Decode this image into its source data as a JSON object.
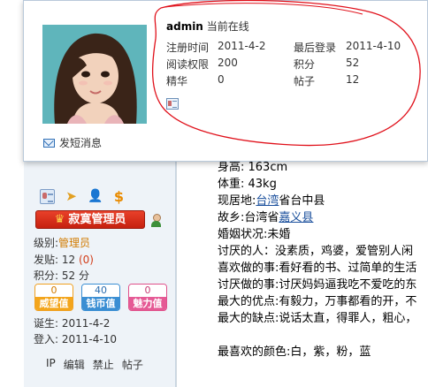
{
  "popup": {
    "username": "admin",
    "online_status": "当前在线",
    "info": [
      {
        "label": "注册时间",
        "value": "2011-4-2"
      },
      {
        "label": "最后登录",
        "value": "2011-4-10"
      },
      {
        "label": "阅读权限",
        "value": "200"
      },
      {
        "label": "积分",
        "value": "52"
      },
      {
        "label": "精华",
        "value": "0"
      },
      {
        "label": "帖子",
        "value": "12"
      }
    ],
    "pm_label": "发短消息"
  },
  "sidebar": {
    "rank_badge": "寂寞管理员",
    "level_label": "级别:",
    "level_value": "管理员",
    "posts_label": "发贴:",
    "posts_value": "12",
    "posts_extra": "(0)",
    "points_label": "积分:",
    "points_value": "52 分",
    "scores": [
      {
        "value": "0",
        "label": "威望值"
      },
      {
        "value": "40",
        "label": "钱币值"
      },
      {
        "value": "0",
        "label": "魅力值"
      }
    ],
    "born_label": "诞生:",
    "born_value": "2011-4-2",
    "login_label": "登入:",
    "login_value": "2011-4-10",
    "actions": [
      "IP",
      "编辑",
      "禁止",
      "帖子"
    ]
  },
  "bio": {
    "height": "身高: 163cm",
    "weight": "体重: 43kg",
    "residence_prefix": "现居地:",
    "residence_link": "台湾",
    "residence_suffix": "省台中县",
    "hometown_prefix": "故乡:台湾省",
    "hometown_link": "嘉义县",
    "marital": "婚姻状况:未婚",
    "dislike_people": "讨厌的人：没素质，鸡婆，爱管别人闲",
    "like_do": "喜欢做的事:看好看的书、过简单的生活",
    "dislike_do": "讨厌做的事:讨厌妈妈逼我吃不爱吃的东",
    "strength": "最大的优点:有毅力，万事都看的开，不",
    "weakness": "最大的缺点:说话太直，得罪人，粗心，",
    "fav_color": "最喜欢的颜色:白，紫，粉，蓝"
  },
  "colors": {
    "annotation": "#e0101a",
    "rank_badge": "#d22a14",
    "link": "#1a4f9c"
  }
}
